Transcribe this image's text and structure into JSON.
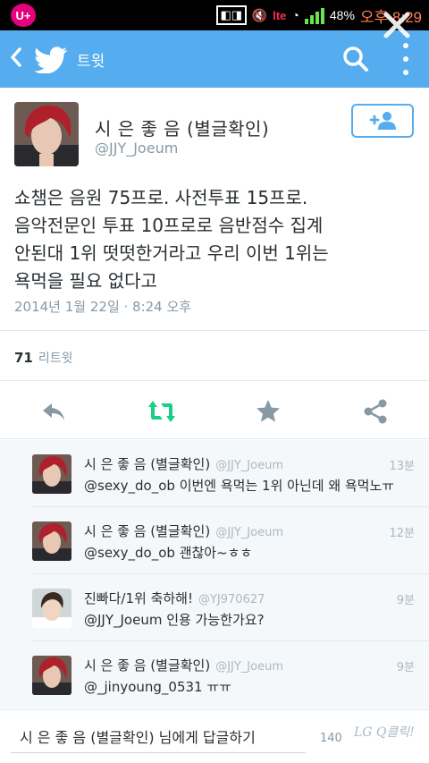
{
  "statusbar": {
    "carrier": "U+",
    "network": "lte",
    "battery": "48%",
    "time": "오후 8:29"
  },
  "header": {
    "title": "트윗",
    "icons": [
      "back-icon",
      "twitter-bird-icon",
      "search-icon",
      "overflow-menu-icon"
    ]
  },
  "tweet": {
    "author_name": "시 은 좋 음 (별글확인)",
    "author_handle": "@JJY_Joeum",
    "text_lines": [
      "쇼챔은 음원 75프로. 사전투표 15프로.",
      "음악전문인 투표 10프로로 음반점수 집계",
      "안된대 1위 떳떳한거라고 우리 이번 1위는",
      "욕먹을 필요 없다고"
    ],
    "date": "2014년 1월 22일 · 8:24 오후",
    "retweet_count": "71",
    "retweet_label": "리트윗"
  },
  "actions": [
    "reply-icon",
    "retweet-icon",
    "favorite-icon",
    "share-icon"
  ],
  "replies": [
    {
      "name": "시 은 좋 음 (별글확인)",
      "handle": "@JJY_Joeum",
      "time": "13분",
      "text": "@sexy_do_ob 이번엔 욕먹는 1위 아닌데 왜 욕먹노ㅠ"
    },
    {
      "name": "시 은 좋 음 (별글확인)",
      "handle": "@JJY_Joeum",
      "time": "12분",
      "text": "@sexy_do_ob 괜찮아~ㅎㅎ"
    },
    {
      "name": "진빠다/1위 축하해!",
      "handle": "@YJ970627",
      "time": "9분",
      "text": "@JJY_Joeum 인용 가능한가요?"
    },
    {
      "name": "시 은 좋 음 (별글확인)",
      "handle": "@JJY_Joeum",
      "time": "9분",
      "text": "@_jinyoung_0531 ㅠㅠ"
    }
  ],
  "compose": {
    "placeholder": "시 은 좋 음 (별글확인) 님에게 답글하기",
    "char_count": "140",
    "watermark": "LG Q클릭!"
  },
  "colors": {
    "twitter_blue": "#55acee",
    "retweet_green": "#19cf86",
    "icon_gray": "#8899a6"
  }
}
